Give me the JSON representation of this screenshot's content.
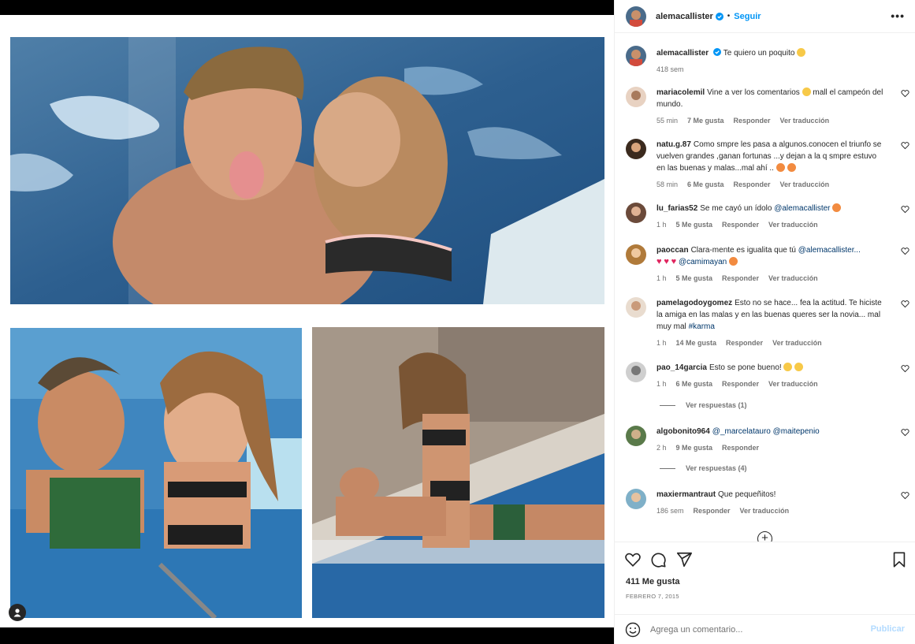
{
  "header": {
    "username": "alemacallister",
    "separator": "•",
    "follow_label": "Seguir",
    "more_label": "•••",
    "avatar_icon": "profile-avatar-icon",
    "verified_color": "#0095f6"
  },
  "caption": {
    "username": "alemacallister",
    "text": "Te quiero un poquito",
    "emoji": "heart-eyes-emoji",
    "time": "418 sem"
  },
  "comments": [
    {
      "user": "mariacolemil",
      "text": "Vine a ver los comentarios",
      "text2": " mall el campeón del mundo.",
      "time": "55 min",
      "likes": "7 Me gusta",
      "reply": "Responder",
      "translate": "Ver traducción"
    },
    {
      "user": "natu.g.87",
      "text": "Como smpre les pasa a algunos.conocen el triunfo se vuelven grandes ,ganan fortunas ...y dejan a la q smpre estuvo en las buenas y malas...mal ahí ..",
      "time": "58 min",
      "likes": "6 Me gusta",
      "reply": "Responder",
      "translate": "Ver traducción"
    },
    {
      "user": "lu_farias52",
      "text": "Se me cayó un ídolo",
      "mention": "@alemacallister",
      "time": "1 h",
      "likes": "5 Me gusta",
      "reply": "Responder",
      "translate": "Ver traducción"
    },
    {
      "user": "paoccan",
      "text": "Clara-mente es igualita que tú",
      "mention": "@alemacallister...",
      "mention2": "@camimayan",
      "time": "1 h",
      "likes": "5 Me gusta",
      "reply": "Responder",
      "translate": "Ver traducción"
    },
    {
      "user": "pamelagodoygomez",
      "text": "Esto no se hace... fea la actitud. Te hiciste la amiga en las malas y en las buenas queres ser la novia... mal muy mal",
      "hashtag": "#karma",
      "time": "1 h",
      "likes": "14 Me gusta",
      "reply": "Responder",
      "translate": "Ver traducción"
    },
    {
      "user": "pao_14garcia",
      "text": "Esto se pone bueno!",
      "time": "1 h",
      "likes": "6 Me gusta",
      "reply": "Responder",
      "translate": "Ver traducción",
      "replies": "Ver respuestas (1)"
    },
    {
      "user": "algobonito964",
      "mention": "@_marcelatauro",
      "mention2": "@maitepenio",
      "time": "2 h",
      "likes": "9 Me gusta",
      "reply": "Responder",
      "replies": "Ver respuestas (4)"
    },
    {
      "user": "maxiermantraut",
      "text": "Que pequeñitos!",
      "time": "186 sem",
      "reply": "Responder",
      "translate": "Ver traducción"
    }
  ],
  "actions": {
    "like_icon": "heart-icon",
    "comment_icon": "comment-icon",
    "share_icon": "share-icon",
    "save_icon": "bookmark-icon",
    "likes": "411 Me gusta",
    "date": "FEBRERO 7, 2015"
  },
  "add_comment": {
    "placeholder": "Agrega un comentario...",
    "publish_label": "Publicar"
  },
  "colors": {
    "accent": "#0095f6",
    "publish_disabled": "#b3dbff",
    "secondary_text": "#737373",
    "pool_water": "#2f6fa8"
  }
}
